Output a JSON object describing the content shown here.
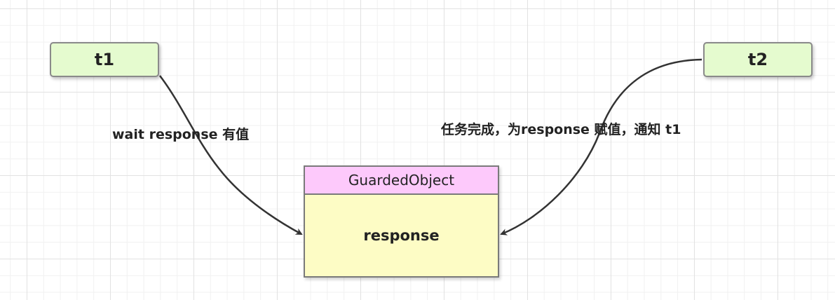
{
  "nodes": {
    "t1": {
      "label": "t1"
    },
    "t2": {
      "label": "t2"
    },
    "guarded_object": {
      "title": "GuardedObject",
      "field": "response"
    }
  },
  "edges": {
    "t1_to_guarded": {
      "label": "wait response 有值"
    },
    "t2_to_guarded": {
      "label": "任务完成，为response 赋值，通知 t1"
    }
  },
  "colors": {
    "thread_fill": "#e5fbcf",
    "class_header_fill": "#fdc9fb",
    "class_body_fill": "#fdfcc5",
    "edge_stroke": "#333333"
  }
}
